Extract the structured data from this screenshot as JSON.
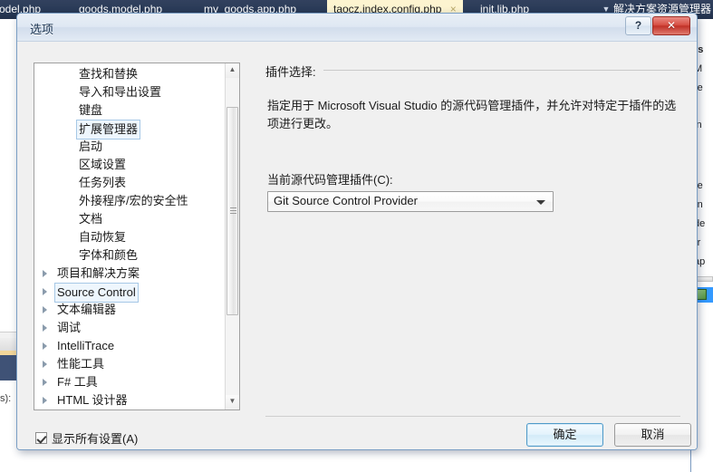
{
  "ide": {
    "tabs": [
      {
        "label": "odel.php",
        "active": false,
        "closable": false
      },
      {
        "label": "goods.model.php",
        "active": false,
        "closable": false
      },
      {
        "label": "my_goods.app.php",
        "active": false,
        "closable": false
      },
      {
        "label": "taocz.index.config.php",
        "active": true,
        "closable": true
      },
      {
        "label": "init.lib.php",
        "active": false,
        "closable": false
      }
    ],
    "tab_close_glyph": "×",
    "tab_dropdown_glyph": "▼",
    "solution_explorer_title": "解决方案资源管理器",
    "solution_lines": [
      "rs",
      "M",
      "re",
      "in",
      "re",
      "rn",
      "de",
      "rr",
      "ap"
    ],
    "editor_left_text": "s):",
    "tab_strip_bg": "#293955",
    "active_tab_bg": "#fdf4d0"
  },
  "dialog": {
    "title": "选项",
    "help_button": "?",
    "close_button": "✕",
    "tree": {
      "items": [
        {
          "label": "查找和替换",
          "child": true,
          "expandable": false,
          "focused": false
        },
        {
          "label": "导入和导出设置",
          "child": true,
          "expandable": false,
          "focused": false
        },
        {
          "label": "键盘",
          "child": true,
          "expandable": false,
          "focused": false
        },
        {
          "label": "扩展管理器",
          "child": true,
          "expandable": false,
          "focused": true
        },
        {
          "label": "启动",
          "child": true,
          "expandable": false,
          "focused": false
        },
        {
          "label": "区域设置",
          "child": true,
          "expandable": false,
          "focused": false
        },
        {
          "label": "任务列表",
          "child": true,
          "expandable": false,
          "focused": false
        },
        {
          "label": "外接程序/宏的安全性",
          "child": true,
          "expandable": false,
          "focused": false
        },
        {
          "label": "文档",
          "child": true,
          "expandable": false,
          "focused": false
        },
        {
          "label": "自动恢复",
          "child": true,
          "expandable": false,
          "focused": false
        },
        {
          "label": "字体和颜色",
          "child": true,
          "expandable": false,
          "focused": false
        },
        {
          "label": "项目和解决方案",
          "child": false,
          "expandable": true,
          "focused": false
        },
        {
          "label": "Source Control",
          "child": false,
          "expandable": true,
          "focused": true
        },
        {
          "label": "文本编辑器",
          "child": false,
          "expandable": true,
          "focused": false
        },
        {
          "label": "调试",
          "child": false,
          "expandable": true,
          "focused": false
        },
        {
          "label": "IntelliTrace",
          "child": false,
          "expandable": true,
          "focused": false
        },
        {
          "label": "性能工具",
          "child": false,
          "expandable": true,
          "focused": false
        },
        {
          "label": "F# 工具",
          "child": false,
          "expandable": true,
          "focused": false
        },
        {
          "label": "HTML 设计器",
          "child": false,
          "expandable": true,
          "focused": false
        }
      ],
      "scroll_up_glyph": "▲",
      "scroll_down_glyph": "▼"
    },
    "panel": {
      "section_label": "插件选择:",
      "description": "指定用于 Microsoft Visual Studio 的源代码管理插件，并允许对特定于插件的选项进行更改。",
      "combo_label": "当前源代码管理插件(C):",
      "combo_value": "Git Source Control Provider",
      "combo_options": [
        "Git Source Control Provider"
      ]
    },
    "footer": {
      "show_all_label": "显示所有设置(A)",
      "show_all_checked": true,
      "ok_label": "确定",
      "cancel_label": "取消"
    }
  }
}
